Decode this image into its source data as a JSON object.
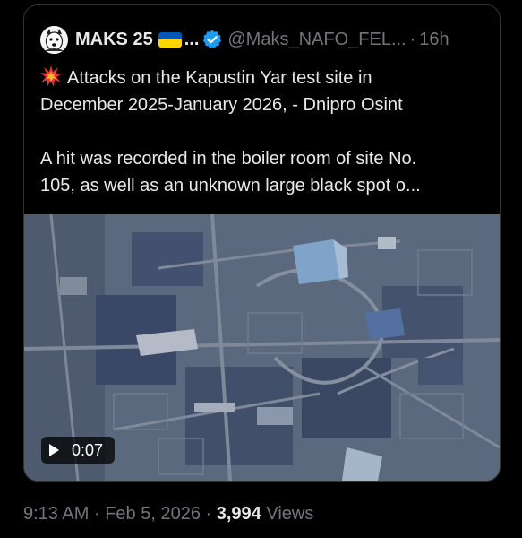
{
  "post": {
    "author_name": "MAKS 25",
    "ellipsis": "...",
    "handle": "@Maks_NAFO_FEL...",
    "separator": "·",
    "relative_time": "16h",
    "line1": "Attacks on the Kapustin Yar test site in",
    "line2": "December 2025-January 2026, - Dnipro Osint",
    "line3": "A hit was recorded in the boiler room of site No.",
    "line4": "105, as well as an unknown large black spot o...",
    "icons": {
      "avatar": "avatar-icon",
      "flag": "ukraine-flag-icon",
      "verified": "verified-badge-icon",
      "emoji": "explosion-icon",
      "play": "play-icon"
    },
    "colors": {
      "verified": "#1d9bf0",
      "flag_blue": "#0057b7",
      "flag_yellow": "#ffd700"
    }
  },
  "media": {
    "type": "video",
    "duration": "0:07"
  },
  "footer": {
    "time": "9:13 AM",
    "sep1": "·",
    "date": "Feb 5, 2026",
    "sep2": "·",
    "views_count": "3,994",
    "views_label": "Views"
  }
}
